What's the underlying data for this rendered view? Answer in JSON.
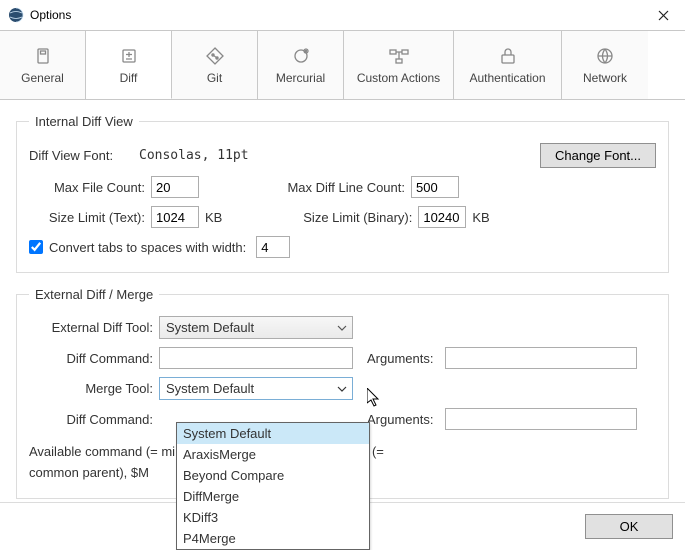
{
  "window": {
    "title": "Options"
  },
  "tabs": [
    {
      "label": "General"
    },
    {
      "label": "Diff"
    },
    {
      "label": "Git"
    },
    {
      "label": "Mercurial"
    },
    {
      "label": "Custom Actions"
    },
    {
      "label": "Authentication"
    },
    {
      "label": "Network"
    }
  ],
  "internal": {
    "legend": "Internal Diff View",
    "font_label": "Diff View Font:",
    "font_value": "Consolas, 11pt",
    "change_font": "Change Font...",
    "max_file_count_label": "Max File Count:",
    "max_file_count_value": "20",
    "max_diff_line_label": "Max Diff Line Count:",
    "max_diff_line_value": "500",
    "size_limit_text_label": "Size Limit (Text):",
    "size_limit_text_value": "1024",
    "size_limit_binary_label": "Size Limit (Binary):",
    "size_limit_binary_value": "10240",
    "kb": "KB",
    "convert_tabs_label": "Convert tabs to spaces with width:",
    "convert_tabs_checked": true,
    "tab_width_value": "4"
  },
  "external": {
    "legend": "External Diff / Merge",
    "diff_tool_label": "External Diff Tool:",
    "diff_tool_value": "System Default",
    "diff_cmd1_label": "Diff Command:",
    "diff_cmd1_value": "",
    "args1_label": "Arguments:",
    "args1_value": "",
    "merge_tool_label": "Merge Tool:",
    "merge_tool_value": "System Default",
    "diff_cmd2_label": "Diff Command:",
    "diff_cmd2_value": "",
    "args2_label": "Arguments:",
    "args2_value": "",
    "available_line1": "Available command                                                       (= mine), $REMOTE (= theirs), $BASE (=",
    "available_line2": "common parent), $M",
    "options": [
      "System Default",
      "AraxisMerge",
      "Beyond Compare",
      "DiffMerge",
      "KDiff3",
      "P4Merge"
    ]
  },
  "buttons": {
    "ok": "OK"
  }
}
